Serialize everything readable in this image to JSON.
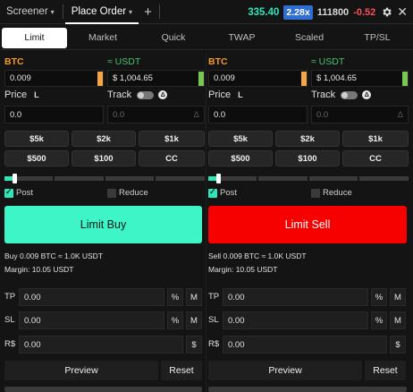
{
  "topbar": {
    "tabs": [
      {
        "label": "Screener"
      },
      {
        "label": "Place Order"
      }
    ],
    "price_green": "335.40",
    "leverage": "2.28x",
    "price_white": "111800",
    "change": "-0.52"
  },
  "order_types": [
    "Limit",
    "Market",
    "Quick",
    "TWAP",
    "Scaled",
    "TP/SL"
  ],
  "buy": {
    "asset_label": "BTC",
    "quote_label": "≈ USDT",
    "qty_value": "0.009",
    "usdt_value": "$ 1,004.65",
    "price_label": "Price",
    "price_mode": "L",
    "track_label": "Track",
    "track_badge": "Δ",
    "price_value": "0.0",
    "track_value": "0.0",
    "track_suffix": "Δ",
    "quick_amounts": [
      "$5k",
      "$2k",
      "$1k",
      "$500",
      "$100",
      "CC"
    ],
    "post_label": "Post",
    "reduce_label": "Reduce",
    "action_label": "Limit Buy",
    "summary": "Buy 0.009 BTC ≈ 1.0K USDT",
    "margin": "Margin: 10.05 USDT",
    "tp_label": "TP",
    "sl_label": "SL",
    "rs_label": "R$",
    "tp_value": "0.00",
    "sl_value": "0.00",
    "rs_value": "0.00",
    "pct_unit": "%",
    "m_unit": "M",
    "dollar_unit": "$",
    "preview_label": "Preview",
    "reset_label": "Reset",
    "slider_fraction": 0.04
  },
  "sell": {
    "asset_label": "BTC",
    "quote_label": "≈ USDT",
    "qty_value": "0.009",
    "usdt_value": "$ 1,004.65",
    "price_label": "Price",
    "price_mode": "L",
    "track_label": "Track",
    "track_badge": "Δ",
    "price_value": "0.0",
    "track_value": "0.0",
    "track_suffix": "Δ",
    "quick_amounts": [
      "$5k",
      "$2k",
      "$1k",
      "$500",
      "$100",
      "CC"
    ],
    "post_label": "Post",
    "reduce_label": "Reduce",
    "action_label": "Limit Sell",
    "summary": "Sell 0.009 BTC ≈ 1.0K USDT",
    "margin": "Margin: 10.05 USDT",
    "tp_label": "TP",
    "sl_label": "SL",
    "rs_label": "R$",
    "tp_value": "0.00",
    "sl_value": "0.00",
    "rs_value": "0.00",
    "pct_unit": "%",
    "m_unit": "M",
    "dollar_unit": "$",
    "preview_label": "Preview",
    "reset_label": "Reset",
    "slider_fraction": 0.04
  },
  "colors": {
    "buy_accent": "#3ef5c8",
    "sell_accent": "#f70000",
    "price_up": "#2ee6b8",
    "change_down": "#ff4d5a",
    "leverage_badge": "#2f6fd1"
  }
}
